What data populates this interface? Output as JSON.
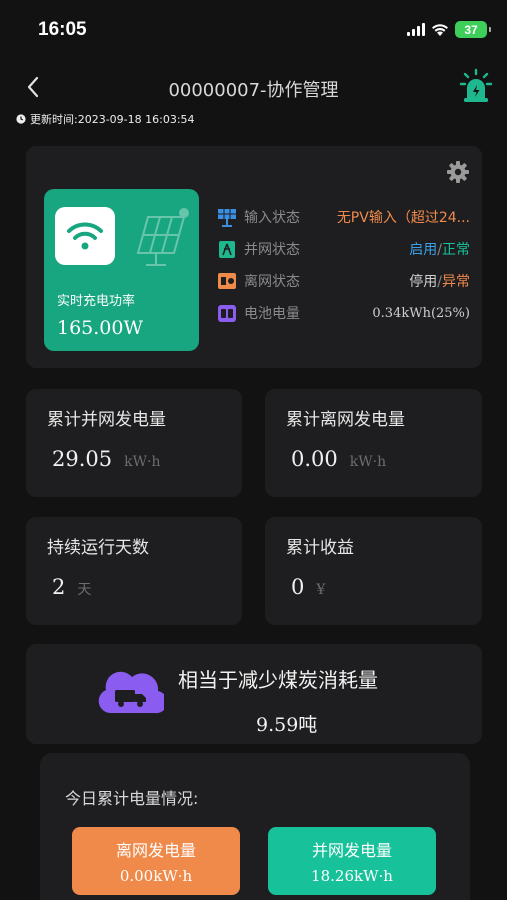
{
  "status_bar": {
    "time": "16:05",
    "battery": "37"
  },
  "nav": {
    "title": "00000007-协作管理"
  },
  "update": {
    "text": "更新时间:2023-09-18 16:03:54"
  },
  "power": {
    "label": "实时充电功率",
    "value": "165.00W"
  },
  "status": {
    "input": {
      "label": "输入状态",
      "value": "无PV输入（超过24..."
    },
    "grid": {
      "label": "并网状态",
      "value_a": "启用",
      "sep": "/",
      "value_b": "正常"
    },
    "offgrid": {
      "label": "离网状态",
      "value_a": "停用",
      "sep": "/",
      "value_b": "异常"
    },
    "battery": {
      "label": "电池电量",
      "value": "0.34kWh(25%)"
    }
  },
  "stats": {
    "grid_gen": {
      "label": "累计并网发电量",
      "value": "29.05",
      "unit": "kW·h"
    },
    "offgrid_gen": {
      "label": "累计离网发电量",
      "value": "0.00",
      "unit": "kW·h"
    },
    "run_days": {
      "label": "持续运行天数",
      "value": "2",
      "unit": "天"
    },
    "income": {
      "label": "累计收益",
      "value": "0",
      "unit": "¥"
    }
  },
  "coal": {
    "title": "相当于减少煤炭消耗量",
    "value": "9.59吨"
  },
  "today": {
    "title": "今日累计电量情况:",
    "offgrid": {
      "label": "离网发电量",
      "value": "0.00kW·h"
    },
    "grid": {
      "label": "并网发电量",
      "value": "18.26kW·h"
    }
  },
  "colors": {
    "accent_green": "#17a680",
    "status_orange": "#f08a4b",
    "status_blue": "#3aa0e8",
    "status_green": "#17c19a",
    "purple": "#8a5cf0"
  }
}
